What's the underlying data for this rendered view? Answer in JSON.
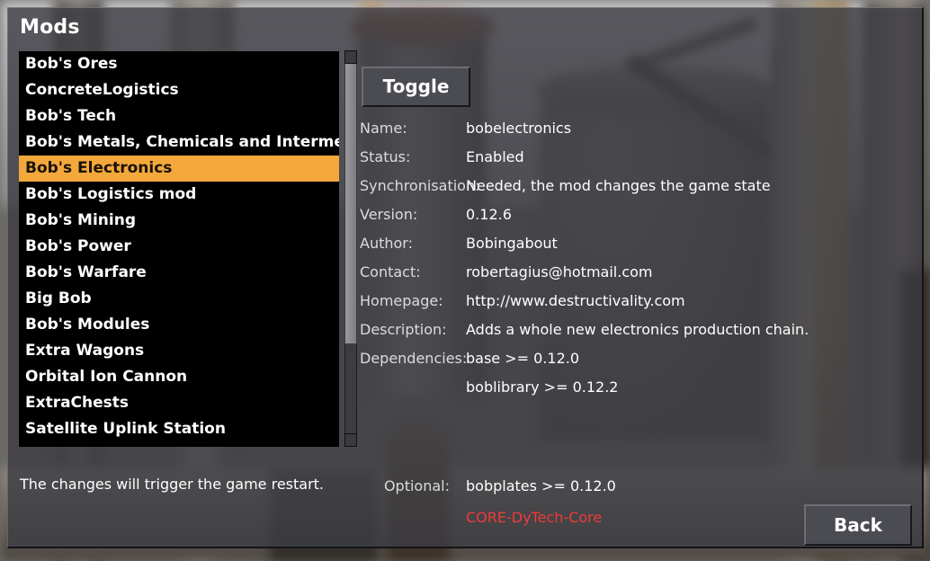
{
  "window": {
    "title": "Mods"
  },
  "mod_list": {
    "items": [
      {
        "label": "Bob's Ores",
        "selected": false
      },
      {
        "label": "ConcreteLogistics",
        "selected": false
      },
      {
        "label": "Bob's Tech",
        "selected": false
      },
      {
        "label": "Bob's Metals, Chemicals and Intermediate",
        "selected": false
      },
      {
        "label": "Bob's Electronics",
        "selected": true
      },
      {
        "label": "Bob's Logistics mod",
        "selected": false
      },
      {
        "label": "Bob's Mining",
        "selected": false
      },
      {
        "label": "Bob's Power",
        "selected": false
      },
      {
        "label": "Bob's Warfare",
        "selected": false
      },
      {
        "label": "Big Bob",
        "selected": false
      },
      {
        "label": "Bob's Modules",
        "selected": false
      },
      {
        "label": "Extra Wagons",
        "selected": false
      },
      {
        "label": "Orbital Ion Cannon",
        "selected": false
      },
      {
        "label": "ExtraChests",
        "selected": false
      },
      {
        "label": "Satellite Uplink Station",
        "selected": false
      }
    ],
    "scrollbar": {
      "up_icon": "scroll-up-icon",
      "down_icon": "scroll-down-icon"
    }
  },
  "details": {
    "toggle_label": "Toggle",
    "rows": [
      {
        "label": "Name:",
        "value": "bobelectronics"
      },
      {
        "label": "Status:",
        "value": "Enabled"
      },
      {
        "label": "Synchronisation:",
        "value": "Needed, the mod changes the game state"
      },
      {
        "label": "Version:",
        "value": "0.12.6"
      },
      {
        "label": "Author:",
        "value": "Bobingabout"
      },
      {
        "label": "Contact:",
        "value": "robertagius@hotmail.com"
      },
      {
        "label": "Homepage:",
        "value": "http://www.destructivality.com"
      },
      {
        "label": "Description:",
        "value": "Adds a whole new electronics production chain."
      },
      {
        "label": "Dependencies:",
        "value": "base >= 0.12.0"
      },
      {
        "label": "",
        "value": "boblibrary >= 0.12.2"
      }
    ]
  },
  "optional": {
    "label": "Optional:",
    "entries": [
      {
        "text": "bobplates >= 0.12.0",
        "missing": false
      },
      {
        "text": "CORE-DyTech-Core",
        "missing": true
      }
    ]
  },
  "footer": {
    "status_text": "The changes will trigger the game restart.",
    "back_label": "Back"
  },
  "colors": {
    "selection": "#f4a83c",
    "missing_dependency": "#ef3b3b",
    "dialog_background": "#3c3c42",
    "list_background": "#000000"
  }
}
